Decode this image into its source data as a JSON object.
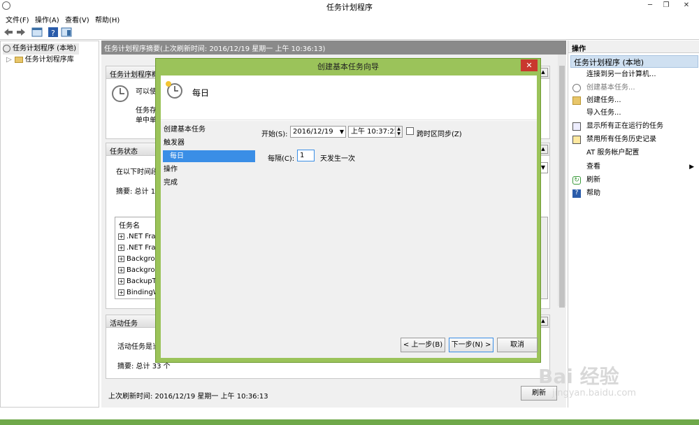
{
  "window": {
    "title": "任务计划程序",
    "min": "─",
    "restore": "❐",
    "close": "✕"
  },
  "menu": [
    "文件(F)",
    "操作(A)",
    "查看(V)",
    "帮助(H)"
  ],
  "tree": {
    "root": "任务计划程序 (本地)",
    "library": "任务计划程序库"
  },
  "center": {
    "header": "任务计划程序摘要(上次刷新时间: 2016/12/19 星期一 上午 10:36:13)",
    "overview": {
      "title": "任务计划程序概",
      "line1": "可以使",
      "line2": "任务存",
      "line3": "单中单"
    },
    "status": {
      "title": "任务状态",
      "desc": "在以下时间段",
      "summary": "摘要: 总计 14",
      "col_name": "任务名",
      "rows": [
        ".NET Fran",
        ".NET Fran",
        "Backgrou",
        "Backgrou",
        "BackupTa",
        "BindingW"
      ]
    },
    "active": {
      "title": "活动任务",
      "desc": "活动任务是当",
      "summary": "摘要: 总计 33 个"
    },
    "footer_time": "上次刷新时间: 2016/12/19 星期一 上午 10:36:13",
    "refresh_button": "刷新"
  },
  "actions": {
    "header": "操作",
    "subheader": "任务计划程序 (本地)",
    "items": [
      "连接到另一台计算机...",
      "创建基本任务...",
      "创建任务...",
      "导入任务...",
      "显示所有正在运行的任务",
      "禁用所有任务历史记录",
      "AT 服务帐户配置",
      "查看",
      "刷新",
      "帮助"
    ]
  },
  "dialog": {
    "title": "创建基本任务向导",
    "close": "✕",
    "heading": "每日",
    "steps": [
      "创建基本任务",
      "触发器",
      "每日",
      "操作",
      "完成"
    ],
    "start_label": "开始(S):",
    "start_date": "2016/12/19",
    "start_time": "上午 10:37:22",
    "sync_label": "跨时区同步(Z)",
    "recur_label": "每隔(C):",
    "recur_value": "1",
    "recur_suffix": "天发生一次",
    "back_button": "< 上一步(B)",
    "next_button": "下一步(N) >",
    "cancel_button": "取消"
  },
  "watermark": {
    "line1": "Bai 经验",
    "line2": "jingyan.baidu.com"
  },
  "colors": {
    "dialog_frame": "#9bc35a",
    "selection": "#3a8ee6",
    "close": "#c9382e"
  }
}
